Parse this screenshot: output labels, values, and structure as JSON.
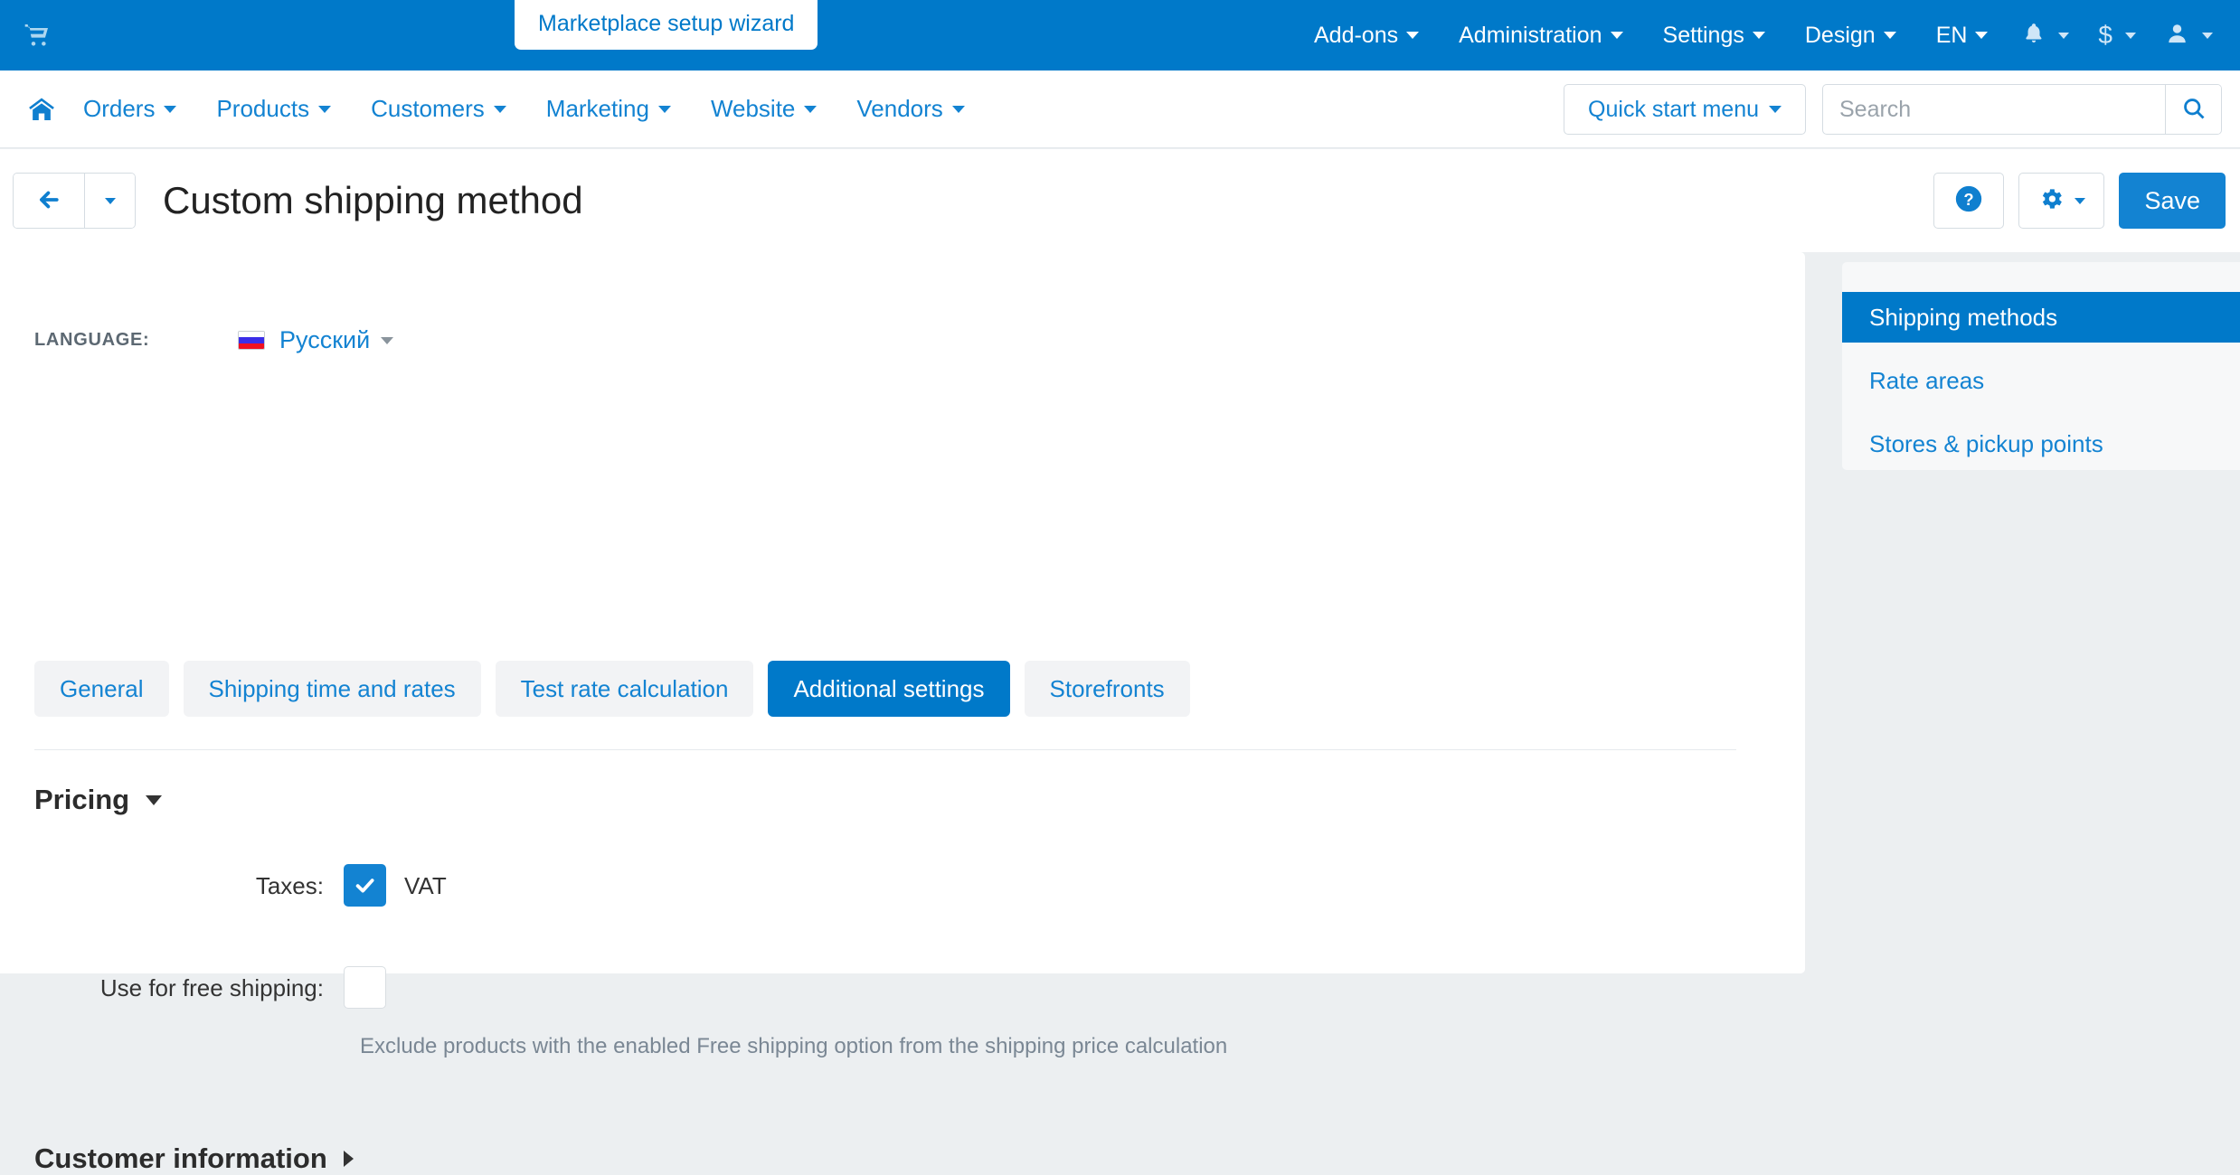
{
  "topbar": {
    "cart_icon": "shopping-cart-icon",
    "wizard_label": "Marketplace setup wizard",
    "menus": [
      {
        "label": "Add-ons"
      },
      {
        "label": "Administration"
      },
      {
        "label": "Settings"
      },
      {
        "label": "Design"
      },
      {
        "label": "EN"
      }
    ],
    "icons": [
      {
        "name": "bell-icon"
      },
      {
        "name": "dollar-icon",
        "glyph": "$"
      },
      {
        "name": "user-icon"
      }
    ],
    "bg_color": "#0079c9"
  },
  "navbar": {
    "home_icon": "home-icon",
    "items": [
      {
        "label": "Orders"
      },
      {
        "label": "Products"
      },
      {
        "label": "Customers"
      },
      {
        "label": "Marketing"
      },
      {
        "label": "Website"
      },
      {
        "label": "Vendors"
      }
    ],
    "quick_start_label": "Quick start menu",
    "search": {
      "value": "",
      "placeholder": "Search",
      "icon": "search-icon"
    }
  },
  "titlebar": {
    "back_icon": "arrow-left-icon",
    "title": "Custom shipping method",
    "help_icon": "question-circle-icon",
    "gear_icon": "gear-icon",
    "save_label": "Save"
  },
  "content": {
    "language": {
      "label": "LANGUAGE:",
      "selected": "Русский",
      "flag": "flag-russia-icon"
    },
    "tabs": [
      {
        "label": "General",
        "active": false
      },
      {
        "label": "Shipping time and rates",
        "active": false
      },
      {
        "label": "Test rate calculation",
        "active": false
      },
      {
        "label": "Additional settings",
        "active": true
      },
      {
        "label": "Storefronts",
        "active": false
      }
    ],
    "pricing": {
      "heading": "Pricing",
      "expanded": true,
      "taxes": {
        "label": "Taxes:",
        "option_label": "VAT",
        "checked": true
      },
      "free_shipping": {
        "label": "Use for free shipping:",
        "checked": false,
        "helper": "Exclude products with the enabled Free shipping option from the shipping price calculation"
      }
    },
    "customer_information": {
      "heading": "Customer information",
      "expanded": false
    }
  },
  "sidebar": {
    "items": [
      {
        "label": "Shipping methods",
        "active": true
      },
      {
        "label": "Rate areas",
        "active": false
      },
      {
        "label": "Stores & pickup points",
        "active": false
      }
    ],
    "accent_color": "#0079c9"
  }
}
